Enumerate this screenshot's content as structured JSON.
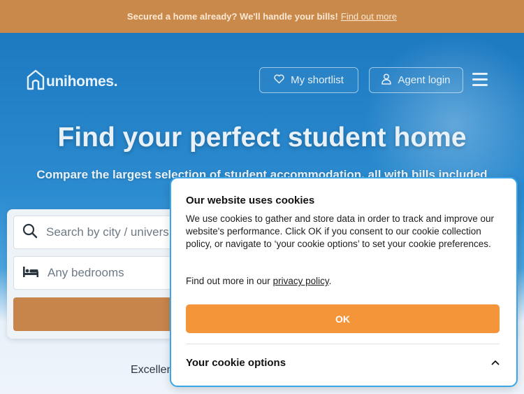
{
  "banner": {
    "text": "Secured a home already? We'll handle your bills!",
    "link": "Find out more"
  },
  "header": {
    "logo_text": "unihomes.",
    "shortlist_label": "My shortlist",
    "agent_login_label": "Agent login"
  },
  "hero": {
    "title": "Find your perfect student home",
    "subtitle": "Compare the largest selection of student accommodation, all with bills included"
  },
  "search": {
    "location_placeholder": "Search by city / univers",
    "bedrooms_value": "Any bedrooms"
  },
  "rating": {
    "text": "Excellen"
  },
  "cookie_banner": {
    "title": "Our website uses cookies",
    "body": "We use cookies to gather and store data in order to track and improve our website's performance. Click OK if you consent to our cookie collection policy, or navigate to ‘your cookie options’ to set your cookie preferences.",
    "more_prefix": "Find out more in our ",
    "privacy_link": "privacy policy",
    "more_suffix": ".",
    "ok_label": "OK",
    "options_label": "Your cookie options"
  },
  "colors": {
    "banner": "#c8894a",
    "hero": "#1d79c0",
    "accent": "#f4953a",
    "cookie_border": "#3aa6e8"
  },
  "icons": [
    "home-logo-icon",
    "heart-icon",
    "user-icon",
    "hamburger-menu-icon",
    "search-icon",
    "bed-icon",
    "chevron-up-icon"
  ]
}
